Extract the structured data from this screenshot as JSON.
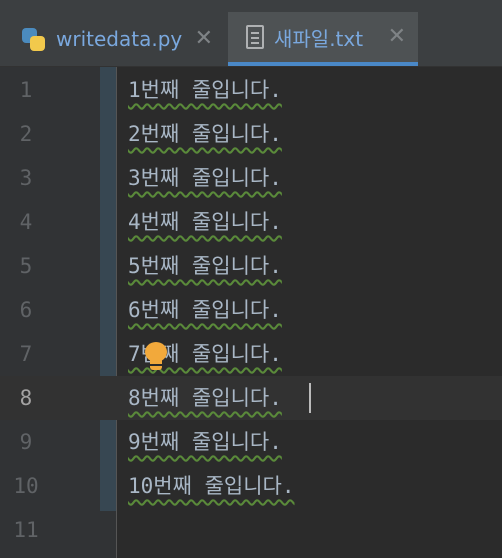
{
  "tabs": [
    {
      "label": "writedata.py",
      "icon": "python-file-icon",
      "close": "✕",
      "active": false
    },
    {
      "label": "새파일.txt",
      "icon": "text-file-icon",
      "close": "✕",
      "active": true
    }
  ],
  "editor": {
    "current_line": 8,
    "lines": [
      {
        "num": "1",
        "text": "1번째 줄입니다."
      },
      {
        "num": "2",
        "text": "2번째 줄입니다."
      },
      {
        "num": "3",
        "text": "3번째 줄입니다."
      },
      {
        "num": "4",
        "text": "4번째 줄입니다."
      },
      {
        "num": "5",
        "text": "5번째 줄입니다."
      },
      {
        "num": "6",
        "text": "6번째 줄입니다."
      },
      {
        "num": "7",
        "text": "7번째 줄입니다."
      },
      {
        "num": "8",
        "text": "8번째 줄입니다."
      },
      {
        "num": "9",
        "text": "9번째 줄입니다."
      },
      {
        "num": "10",
        "text": "10번째 줄입니다."
      },
      {
        "num": "11",
        "text": ""
      }
    ]
  },
  "colors": {
    "accent": "#4a88c7",
    "intention_bulb": "#f2a93b",
    "typo_underline": "#5a8a3a"
  }
}
